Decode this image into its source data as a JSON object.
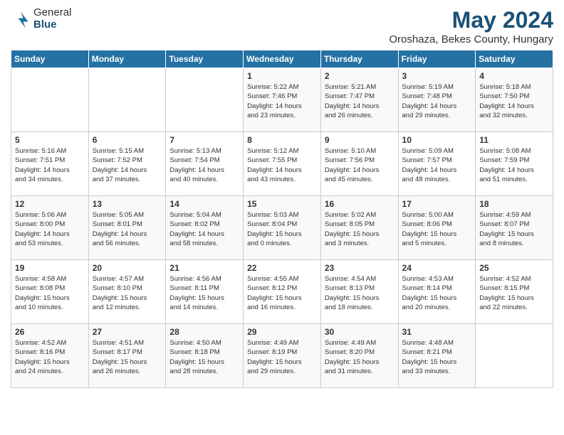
{
  "header": {
    "logo_general": "General",
    "logo_blue": "Blue",
    "title": "May 2024",
    "subtitle": "Oroshaza, Bekes County, Hungary"
  },
  "weekdays": [
    "Sunday",
    "Monday",
    "Tuesday",
    "Wednesday",
    "Thursday",
    "Friday",
    "Saturday"
  ],
  "weeks": [
    [
      {
        "day": "",
        "info": ""
      },
      {
        "day": "",
        "info": ""
      },
      {
        "day": "",
        "info": ""
      },
      {
        "day": "1",
        "info": "Sunrise: 5:22 AM\nSunset: 7:46 PM\nDaylight: 14 hours\nand 23 minutes."
      },
      {
        "day": "2",
        "info": "Sunrise: 5:21 AM\nSunset: 7:47 PM\nDaylight: 14 hours\nand 26 minutes."
      },
      {
        "day": "3",
        "info": "Sunrise: 5:19 AM\nSunset: 7:48 PM\nDaylight: 14 hours\nand 29 minutes."
      },
      {
        "day": "4",
        "info": "Sunrise: 5:18 AM\nSunset: 7:50 PM\nDaylight: 14 hours\nand 32 minutes."
      }
    ],
    [
      {
        "day": "5",
        "info": "Sunrise: 5:16 AM\nSunset: 7:51 PM\nDaylight: 14 hours\nand 34 minutes."
      },
      {
        "day": "6",
        "info": "Sunrise: 5:15 AM\nSunset: 7:52 PM\nDaylight: 14 hours\nand 37 minutes."
      },
      {
        "day": "7",
        "info": "Sunrise: 5:13 AM\nSunset: 7:54 PM\nDaylight: 14 hours\nand 40 minutes."
      },
      {
        "day": "8",
        "info": "Sunrise: 5:12 AM\nSunset: 7:55 PM\nDaylight: 14 hours\nand 43 minutes."
      },
      {
        "day": "9",
        "info": "Sunrise: 5:10 AM\nSunset: 7:56 PM\nDaylight: 14 hours\nand 45 minutes."
      },
      {
        "day": "10",
        "info": "Sunrise: 5:09 AM\nSunset: 7:57 PM\nDaylight: 14 hours\nand 48 minutes."
      },
      {
        "day": "11",
        "info": "Sunrise: 5:08 AM\nSunset: 7:59 PM\nDaylight: 14 hours\nand 51 minutes."
      }
    ],
    [
      {
        "day": "12",
        "info": "Sunrise: 5:06 AM\nSunset: 8:00 PM\nDaylight: 14 hours\nand 53 minutes."
      },
      {
        "day": "13",
        "info": "Sunrise: 5:05 AM\nSunset: 8:01 PM\nDaylight: 14 hours\nand 56 minutes."
      },
      {
        "day": "14",
        "info": "Sunrise: 5:04 AM\nSunset: 8:02 PM\nDaylight: 14 hours\nand 58 minutes."
      },
      {
        "day": "15",
        "info": "Sunrise: 5:03 AM\nSunset: 8:04 PM\nDaylight: 15 hours\nand 0 minutes."
      },
      {
        "day": "16",
        "info": "Sunrise: 5:02 AM\nSunset: 8:05 PM\nDaylight: 15 hours\nand 3 minutes."
      },
      {
        "day": "17",
        "info": "Sunrise: 5:00 AM\nSunset: 8:06 PM\nDaylight: 15 hours\nand 5 minutes."
      },
      {
        "day": "18",
        "info": "Sunrise: 4:59 AM\nSunset: 8:07 PM\nDaylight: 15 hours\nand 8 minutes."
      }
    ],
    [
      {
        "day": "19",
        "info": "Sunrise: 4:58 AM\nSunset: 8:08 PM\nDaylight: 15 hours\nand 10 minutes."
      },
      {
        "day": "20",
        "info": "Sunrise: 4:57 AM\nSunset: 8:10 PM\nDaylight: 15 hours\nand 12 minutes."
      },
      {
        "day": "21",
        "info": "Sunrise: 4:56 AM\nSunset: 8:11 PM\nDaylight: 15 hours\nand 14 minutes."
      },
      {
        "day": "22",
        "info": "Sunrise: 4:55 AM\nSunset: 8:12 PM\nDaylight: 15 hours\nand 16 minutes."
      },
      {
        "day": "23",
        "info": "Sunrise: 4:54 AM\nSunset: 8:13 PM\nDaylight: 15 hours\nand 18 minutes."
      },
      {
        "day": "24",
        "info": "Sunrise: 4:53 AM\nSunset: 8:14 PM\nDaylight: 15 hours\nand 20 minutes."
      },
      {
        "day": "25",
        "info": "Sunrise: 4:52 AM\nSunset: 8:15 PM\nDaylight: 15 hours\nand 22 minutes."
      }
    ],
    [
      {
        "day": "26",
        "info": "Sunrise: 4:52 AM\nSunset: 8:16 PM\nDaylight: 15 hours\nand 24 minutes."
      },
      {
        "day": "27",
        "info": "Sunrise: 4:51 AM\nSunset: 8:17 PM\nDaylight: 15 hours\nand 26 minutes."
      },
      {
        "day": "28",
        "info": "Sunrise: 4:50 AM\nSunset: 8:18 PM\nDaylight: 15 hours\nand 28 minutes."
      },
      {
        "day": "29",
        "info": "Sunrise: 4:49 AM\nSunset: 8:19 PM\nDaylight: 15 hours\nand 29 minutes."
      },
      {
        "day": "30",
        "info": "Sunrise: 4:49 AM\nSunset: 8:20 PM\nDaylight: 15 hours\nand 31 minutes."
      },
      {
        "day": "31",
        "info": "Sunrise: 4:48 AM\nSunset: 8:21 PM\nDaylight: 15 hours\nand 33 minutes."
      },
      {
        "day": "",
        "info": ""
      }
    ]
  ]
}
